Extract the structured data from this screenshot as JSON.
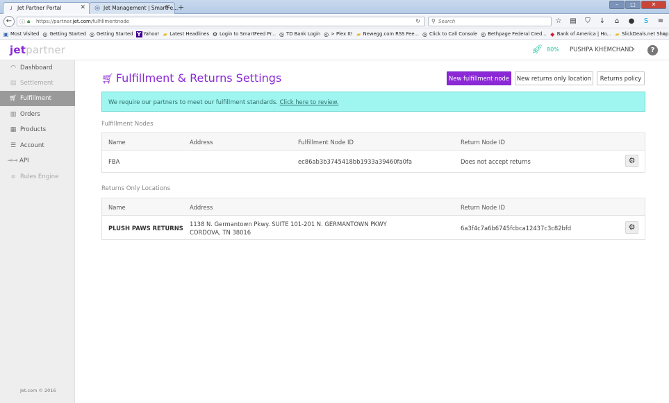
{
  "browser": {
    "tabs": [
      {
        "title": "Jet Partner Portal",
        "active": true
      },
      {
        "title": "Jet Management | SmartFe...",
        "active": false
      }
    ],
    "url_prefix": "https://partner.",
    "url_domain": "jet.com",
    "url_path": "/fulfillmentnode",
    "search_placeholder": "Search",
    "bookmarks": [
      {
        "label": "Most Visited",
        "icon": "bookmark-icon"
      },
      {
        "label": "Getting Started",
        "icon": "globe-icon"
      },
      {
        "label": "Getting Started",
        "icon": "globe-icon"
      },
      {
        "label": "Yahoo!",
        "icon": "yahoo-icon"
      },
      {
        "label": "Latest Headlines",
        "icon": "folder-icon"
      },
      {
        "label": "Login to SmartFeed Pr...",
        "icon": "gear-icon"
      },
      {
        "label": "TD Bank Login",
        "icon": "globe-icon"
      },
      {
        "label": "> Plex It!",
        "icon": "globe-icon"
      },
      {
        "label": "Newegg.com RSS Fee...",
        "icon": "folder-icon"
      },
      {
        "label": "Click to Call Console",
        "icon": "globe-icon"
      },
      {
        "label": "Bethpage Federal Cred...",
        "icon": "globe-icon"
      },
      {
        "label": "Bank of America | Ho...",
        "icon": "boa-icon"
      },
      {
        "label": "SlickDeals.net Shoppin...",
        "icon": "folder-icon"
      }
    ]
  },
  "header": {
    "logo_jet": "jet",
    "logo_partner": "partner",
    "progress": "80%",
    "user": "PUSHPA KHEMCHAND"
  },
  "sidebar": {
    "items": [
      {
        "label": "Dashboard",
        "state": "normal",
        "icon": "dashboard-icon"
      },
      {
        "label": "Settlement",
        "state": "disabled",
        "icon": "settlement-icon"
      },
      {
        "label": "Fulfillment",
        "state": "active",
        "icon": "cart-icon"
      },
      {
        "label": "Orders",
        "state": "normal",
        "icon": "orders-icon"
      },
      {
        "label": "Products",
        "state": "normal",
        "icon": "products-icon"
      },
      {
        "label": "Account",
        "state": "normal",
        "icon": "account-icon"
      },
      {
        "label": "API",
        "state": "normal",
        "icon": "api-icon"
      },
      {
        "label": "Rules Engine",
        "state": "disabled",
        "icon": "rules-icon"
      }
    ],
    "copyright": "Jet.com © 2016"
  },
  "main": {
    "title": "Fulfillment & Returns Settings",
    "buttons": {
      "new_node": "New fulfillment node",
      "new_returns": "New returns only location",
      "returns_policy": "Returns policy"
    },
    "notice_text": "We require our partners to meet our fulfillment standards.",
    "notice_link": "Click here to review.",
    "fulfillment_section": "Fulfillment Nodes",
    "fulfillment_headers": [
      "Name",
      "Address",
      "Fulfillment Node ID",
      "Return Node ID"
    ],
    "fulfillment_rows": [
      {
        "name": "FBA",
        "address": "",
        "node_id": "ec86ab3b3745418bb1933a39460fa0fa",
        "return_id": "Does not accept returns"
      }
    ],
    "returns_section": "Returns Only Locations",
    "returns_headers": [
      "Name",
      "Address",
      "Return Node ID"
    ],
    "returns_rows": [
      {
        "name": "PLUSH PAWS RETURNS",
        "address_line1": "1138 N. Germantown Pkwy. SUITE 101-201 N. GERMANTOWN PKWY",
        "address_line2": "CORDOVA, TN 38016",
        "return_id": "6a3f4c7a6b6745fcbca12437c3c82bfd"
      }
    ]
  },
  "colors": {
    "brand_purple": "#8b29d6",
    "notice_bg": "#9ff5f0",
    "rocket_green": "#27c2a0"
  }
}
